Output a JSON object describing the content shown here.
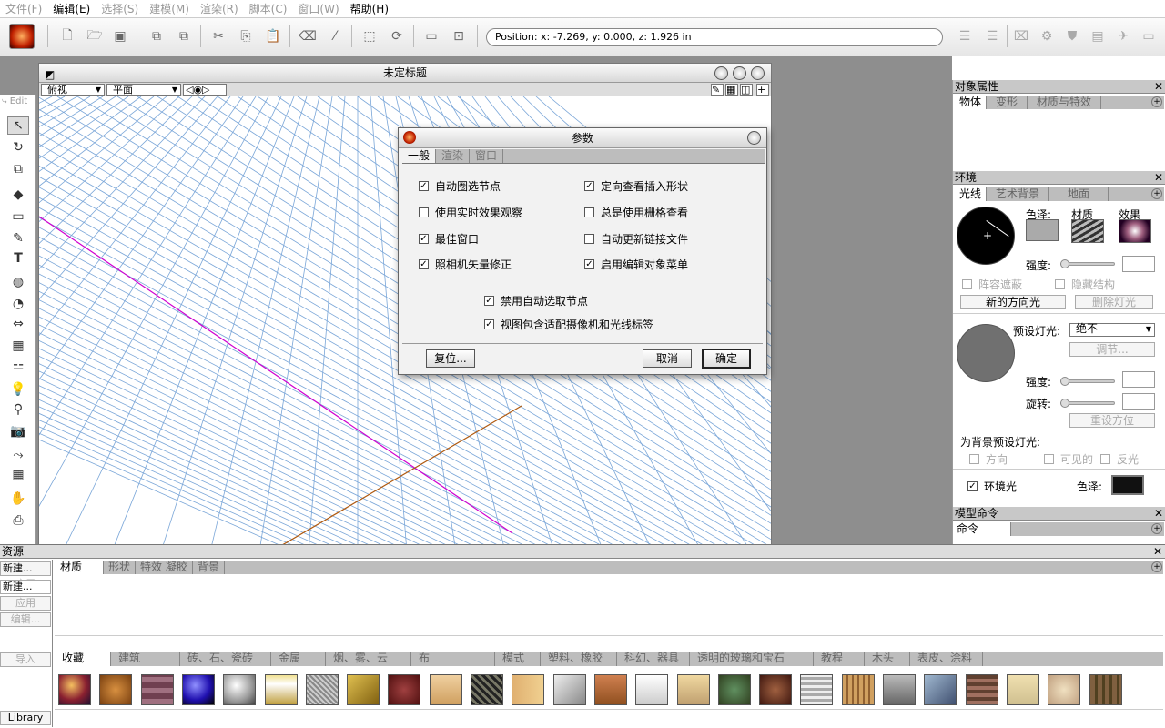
{
  "menu": [
    {
      "label": "文件(F)",
      "active": false
    },
    {
      "label": "编辑(E)",
      "active": true
    },
    {
      "label": "选择(S)",
      "active": false
    },
    {
      "label": "建模(M)",
      "active": false
    },
    {
      "label": "渲染(R)",
      "active": false
    },
    {
      "label": "脚本(C)",
      "active": false
    },
    {
      "label": "窗口(W)",
      "active": false
    },
    {
      "label": "帮助(H)",
      "active": true
    }
  ],
  "toolbar": {
    "position": "Position:  x: -7.269,  y: 0.000,  z: 1.926 in"
  },
  "left_tools": {
    "edit_label": "Edit"
  },
  "viewport": {
    "title": "未定标题",
    "view_select": "俯视",
    "plane_select": "平面"
  },
  "dialog": {
    "title": "参数",
    "tabs": [
      "一般",
      "渲染",
      "窗口"
    ],
    "options": [
      {
        "label": "自动圈选节点",
        "checked": true
      },
      {
        "label": "定向查看插入形状",
        "checked": true
      },
      {
        "label": "使用实时效果观察",
        "checked": false
      },
      {
        "label": "总是使用栅格查看",
        "checked": false
      },
      {
        "label": "最佳窗口",
        "checked": true
      },
      {
        "label": "自动更新链接文件",
        "checked": false
      },
      {
        "label": "照相机矢量修正",
        "checked": true
      },
      {
        "label": "启用编辑对象菜单",
        "checked": true
      },
      {
        "label": "禁用自动选取节点",
        "checked": true
      },
      {
        "label": "视图包含适配摄像机和光线标签",
        "checked": true
      }
    ],
    "reset": "复位...",
    "cancel": "取消",
    "ok": "确定"
  },
  "right_panel": {
    "props_title": "对象属性",
    "props_tabs": [
      "物体",
      "变形",
      "材质与特效"
    ],
    "env_title": "环境",
    "env_tabs": [
      "光线",
      "艺术背景",
      "地面"
    ],
    "color_lbl": "色泽:",
    "material_lbl": "材质",
    "effect_lbl": "效果",
    "intensity_lbl": "强度:",
    "array_shade": "阵容遮蔽",
    "hide_struct": "隐藏结构",
    "new_light": "新的方向光",
    "delete_light": "删除灯光",
    "preset_lbl": "预设灯光:",
    "preset_val": "绝不",
    "adjust": "调节...",
    "intensity2_lbl": "强度:",
    "rotate_lbl": "旋转:",
    "reset_dir": "重设方位",
    "bg_preset": "为背景预设灯光:",
    "dir": "方向",
    "visible": "可见的",
    "reflect": "反光",
    "ambient": "环境光",
    "ambient_color": "色泽:",
    "model_title": "模型命令",
    "model_tab": "命令"
  },
  "resources": {
    "title": "资源",
    "new1": "新建...",
    "new2": "新建...",
    "apply1": "应用",
    "apply2": "应用",
    "edit": "编辑...",
    "tabs": [
      "材质",
      "形状",
      "特效 凝胶",
      "背景"
    ],
    "import": "导入",
    "library": "Library",
    "categories": [
      "收藏",
      "建筑",
      "砖、石、瓷砖",
      "金属",
      "烟、雾、云",
      "布",
      "模式",
      "塑料、橡胶",
      "科幻、器具",
      "透明的玻璃和宝石",
      "教程",
      "木头",
      "表皮、涂料"
    ]
  },
  "colors": {
    "grid": "#7aa6d8",
    "axis_x": "#d000d0",
    "axis_z": "#b05a10"
  }
}
